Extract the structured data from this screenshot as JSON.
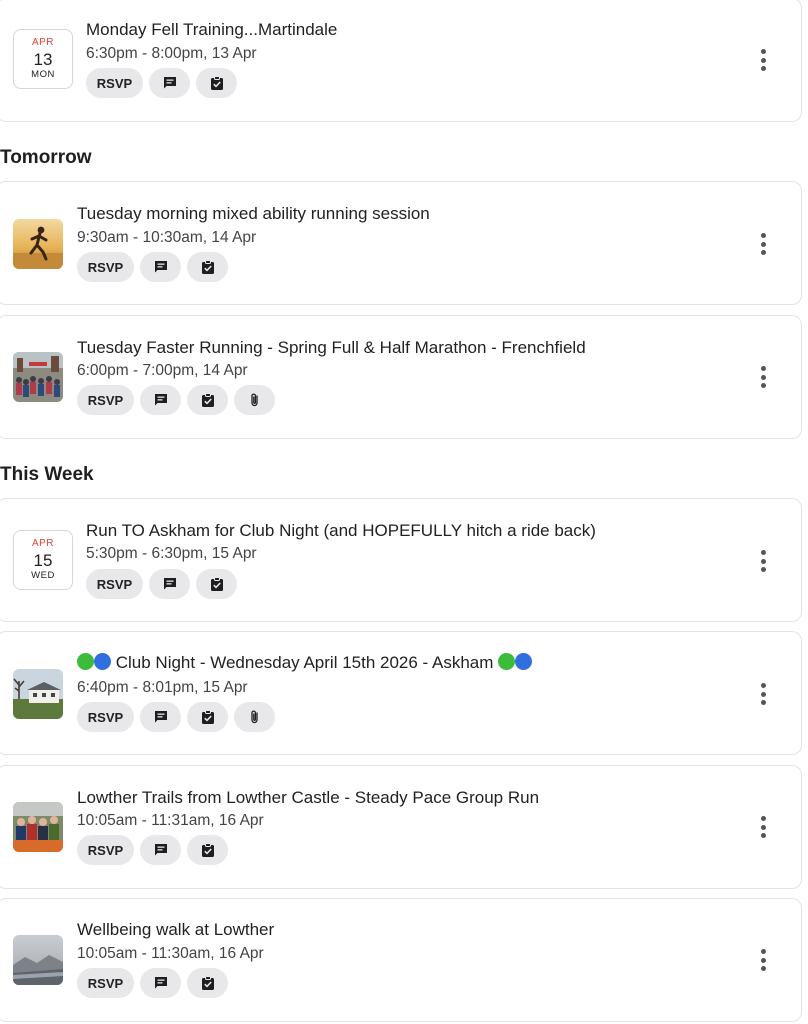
{
  "sections": {
    "tomorrow": "Tomorrow",
    "this_week": "This Week"
  },
  "chip_labels": {
    "rsvp": "RSVP"
  },
  "icons": {
    "comment": "comment-icon",
    "checklist": "checklist-icon",
    "attachment": "attachment-icon",
    "more": "more-vertical-icon"
  },
  "colors": {
    "date_month": "#e0453a",
    "chip_bg": "#e8e8ea",
    "green_dot": "#3dbb3a",
    "blue_dot": "#2f6fe0"
  },
  "events": [
    {
      "title": "Monday Fell Training...Martindale",
      "time": "6:30pm - 8:00pm, 13 Apr",
      "date_month": "APR",
      "date_day": "13",
      "date_dow": "MON"
    },
    {
      "title": "Tuesday morning mixed ability running session",
      "time": "9:30am - 10:30am, 14 Apr",
      "thumb": "runner-photo"
    },
    {
      "title": "Tuesday Faster Running - Spring Full & Half Marathon - Frenchfield",
      "time": "6:00pm - 7:00pm, 14 Apr",
      "thumb": "marathon-crowd-photo"
    },
    {
      "title": "Run TO Askham for Club Night (and HOPEFULLY hitch a ride back)",
      "time": "5:30pm - 6:30pm, 15 Apr",
      "date_month": "APR",
      "date_day": "15",
      "date_dow": "WED"
    },
    {
      "title": "Club Night - Wednesday April 15th 2026 - Askham",
      "time": "6:40pm - 8:01pm, 15 Apr",
      "thumb": "village-house-photo"
    },
    {
      "title": "Lowther Trails from Lowther Castle - Steady Pace Group Run",
      "time": "10:05am - 11:31am, 16 Apr",
      "thumb": "group-runners-photo"
    },
    {
      "title": "Wellbeing walk at Lowther",
      "time": "10:05am - 11:30am, 16 Apr",
      "thumb": "misty-hills-photo"
    }
  ]
}
